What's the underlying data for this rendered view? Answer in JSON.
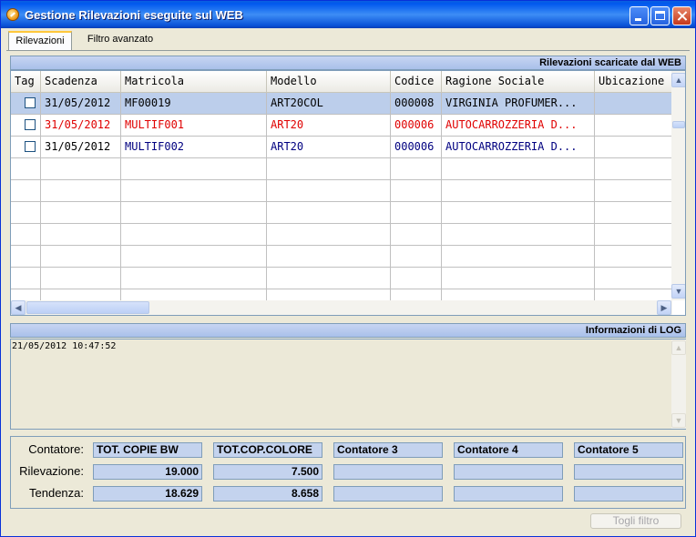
{
  "window": {
    "title": "Gestione Rilevazioni eseguite sul WEB"
  },
  "tabs": [
    {
      "label": "Rilevazioni"
    },
    {
      "label": "Filtro avanzato"
    }
  ],
  "grid": {
    "header": "Rilevazioni scaricate dal WEB",
    "columns": [
      "Tag",
      "Scadenza",
      "Matricola",
      "Modello",
      "Codice",
      "Ragione Sociale",
      "Ubicazione"
    ],
    "rows": [
      {
        "tag": false,
        "scadenza": "31/05/2012",
        "matricola": "MF00019",
        "modello": "ART20COL",
        "codice": "000008",
        "ragione": "VIRGINIA PROFUMER...",
        "ubicazione": ""
      },
      {
        "tag": false,
        "scadenza": "31/05/2012",
        "matricola": "MULTIF001",
        "modello": "ART20",
        "codice": "000006",
        "ragione": "AUTOCARROZZERIA D...",
        "ubicazione": ""
      },
      {
        "tag": false,
        "scadenza": "31/05/2012",
        "matricola": "MULTIF002",
        "modello": "ART20",
        "codice": "000006",
        "ragione": "AUTOCARROZZERIA D...",
        "ubicazione": ""
      }
    ]
  },
  "log": {
    "header": "Informazioni di LOG",
    "text": "21/05/2012 10:47:52"
  },
  "counters": {
    "labels": {
      "contatore": "Contatore:",
      "rilevazione": "Rilevazione:",
      "tendenza": "Tendenza:"
    },
    "names": [
      "TOT. COPIE BW",
      "TOT.COP.COLORE",
      "Contatore 3",
      "Contatore 4",
      "Contatore 5"
    ],
    "rilevazione": [
      "19.000",
      "7.500",
      "",
      "",
      ""
    ],
    "tendenza": [
      "18.629",
      "8.658",
      "",
      "",
      ""
    ]
  },
  "buttons": {
    "togli_filtro": "Togli filtro"
  },
  "colors": {
    "row_selected": "#BCCEEB",
    "row_red": "#E00000",
    "row_blue": "#000080",
    "row_default": "#000000"
  }
}
